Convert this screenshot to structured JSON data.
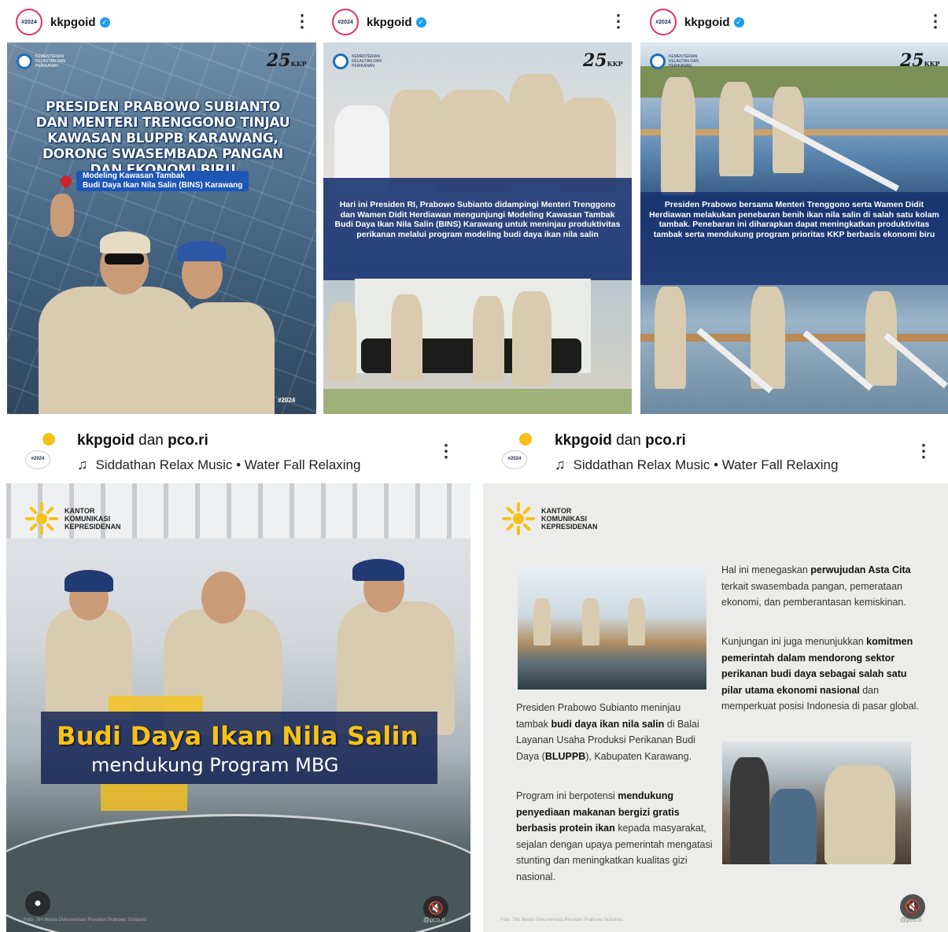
{
  "posts_top": [
    {
      "username": "kkpgoid",
      "avatar_text": "#2024"
    },
    {
      "username": "kkpgoid",
      "avatar_text": "#2024"
    },
    {
      "username": "kkpgoid",
      "avatar_text": "#2024"
    }
  ],
  "slide1": {
    "title": "PRESIDEN PRABOWO SUBIANTO DAN MENTERI TRENGGONO TINJAU KAWASAN BLUPPB KARAWANG, DORONG SWASEMBADA PANGAN DAN EKONOMI BIRU",
    "location_line1": "Modeling Kawasan Tambak",
    "location_line2": "Budi Daya Ikan Nila Salin (BINS) Karawang",
    "badge": "#2024",
    "anniv": "25",
    "anniv_suffix": "KKP"
  },
  "slide2": {
    "caption": "Hari ini Presiden RI, Prabowo Subianto didampingi Menteri Trenggono dan Wamen Didit Herdiawan mengunjungi Modeling Kawasan Tambak Budi Daya Ikan Nila Salin (BINS) Karawang untuk meninjau produktivitas perikanan melalui program modeling budi daya ikan nila salin",
    "anniv": "25",
    "anniv_suffix": "KKP"
  },
  "slide3": {
    "caption": "Presiden Prabowo bersama Menteri Trenggono serta Wamen Didit Herdiawan melakukan penebaran benih ikan nila salin di salah satu kolam tambak. Penebaran ini diharapkan dapat meningkatkan produktivitas tambak serta mendukung program prioritas KKP berbasis ekonomi biru",
    "anniv": "25",
    "anniv_suffix": "KKP"
  },
  "posts_bottom": [
    {
      "author1": "kkpgoid",
      "connector": "dan",
      "author2": "pco.ri",
      "music": "Siddathan Relax Music • Water Fall Relaxing",
      "avatar_text": "#2024"
    },
    {
      "author1": "kkpgoid",
      "connector": "dan",
      "author2": "pco.ri",
      "music": "Siddathan Relax Music • Water Fall Relaxing",
      "avatar_text": "#2024"
    }
  ],
  "reel1": {
    "office_line1": "KANTOR",
    "office_line2": "KOMUNIKASI",
    "office_line3": "KEPRESIDENAN",
    "headline": "Budi Daya Ikan Nila Salin",
    "subheadline": "mendukung Program MBG",
    "credit": "Foto: Tim Media Dokumentasi Presiden Prabowo Subianto",
    "handle": "@pco.ri"
  },
  "reel2": {
    "office_line1": "KANTOR",
    "office_line2": "KOMUNIKASI",
    "office_line3": "KEPRESIDENAN",
    "credit": "Foto: Tim Media Dokumentasi Presiden Prabowo Subianto",
    "handle": "@pco.ri"
  },
  "icons": [
    "verified-badge-icon",
    "more-options-icon",
    "music-note-icon",
    "user-tag-icon",
    "mute-icon",
    "location-pin-icon"
  ],
  "colors": {
    "navy": "#16306e",
    "yellow": "#f6c21a",
    "verified": "#1d9bf0",
    "paper": "#ececea"
  }
}
